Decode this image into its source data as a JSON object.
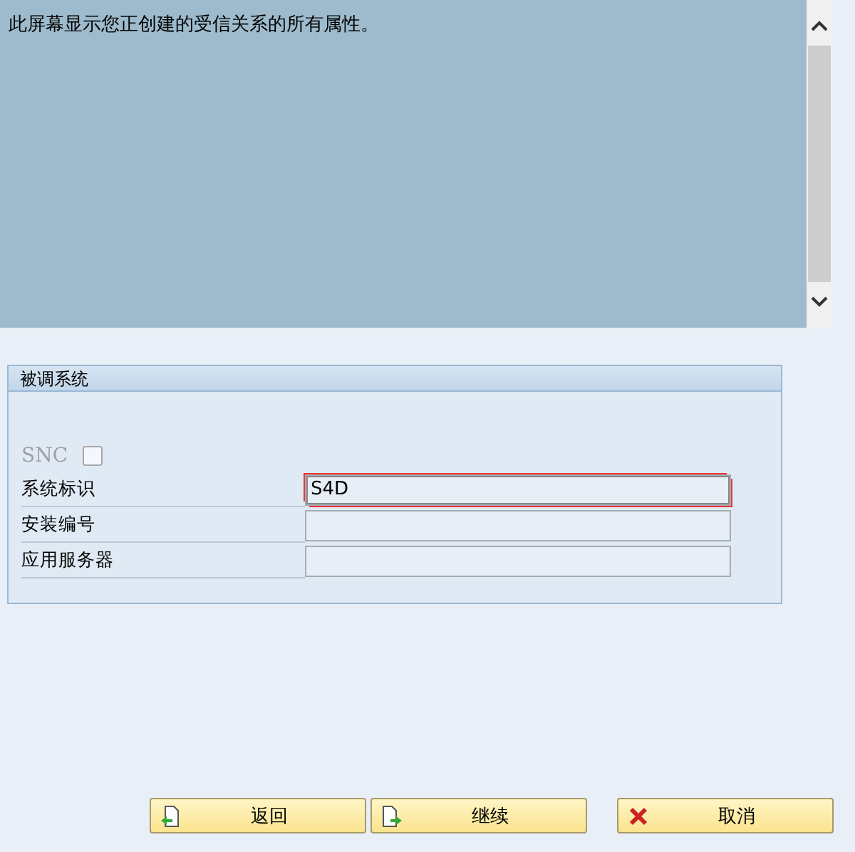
{
  "info_text": "此屏幕显示您正创建的受信关系的所有属性。",
  "group": {
    "title": "被调系统",
    "snc": {
      "label": "SNC",
      "checked": false,
      "disabled": true
    },
    "fields": [
      {
        "label": "系统标识",
        "value": "S4D",
        "focused": true
      },
      {
        "label": "安装编号",
        "focused": false
      },
      {
        "label": "应用服务器",
        "focused": false
      }
    ]
  },
  "buttons": [
    {
      "label": "返回",
      "kind": "back"
    },
    {
      "label": "继续",
      "kind": "next"
    },
    {
      "label": "取消",
      "kind": "cancel"
    }
  ]
}
